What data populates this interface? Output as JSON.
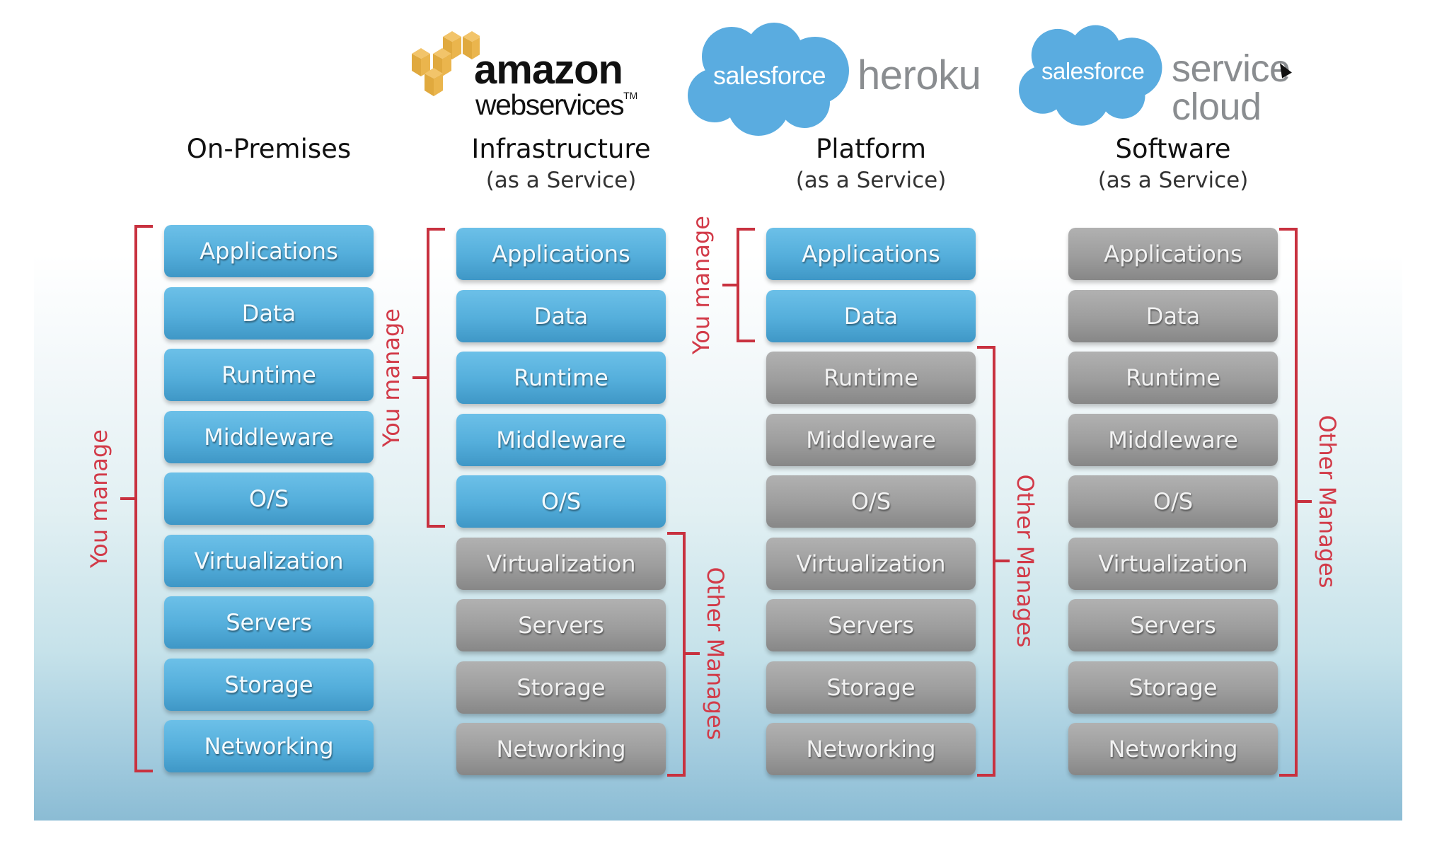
{
  "logos": {
    "aws": {
      "line1": "amazon",
      "line2": "webservices",
      "trademark": "TM",
      "cube_color": "#e8b349"
    },
    "heroku": {
      "cloud_text": "salesforce",
      "product": "heroku",
      "cloud_color": "#5aace0"
    },
    "service_cloud": {
      "cloud_text": "salesforce",
      "product": "service cloud",
      "cloud_color": "#5aace0"
    }
  },
  "colors": {
    "you_manage": "#55addb",
    "other_manages": "#9d9d9d",
    "bracket": "#c8313f"
  },
  "columns": [
    {
      "title": "On-Premises",
      "subtitle": "",
      "layers": [
        {
          "label": "Applications",
          "managed_by": "you"
        },
        {
          "label": "Data",
          "managed_by": "you"
        },
        {
          "label": "Runtime",
          "managed_by": "you"
        },
        {
          "label": "Middleware",
          "managed_by": "you"
        },
        {
          "label": "O/S",
          "managed_by": "you"
        },
        {
          "label": "Virtualization",
          "managed_by": "you"
        },
        {
          "label": "Servers",
          "managed_by": "you"
        },
        {
          "label": "Storage",
          "managed_by": "you"
        },
        {
          "label": "Networking",
          "managed_by": "you"
        }
      ],
      "you_label": "You manage",
      "other_label": ""
    },
    {
      "title": "Infrastructure",
      "subtitle": "(as a Service)",
      "layers": [
        {
          "label": "Applications",
          "managed_by": "you"
        },
        {
          "label": "Data",
          "managed_by": "you"
        },
        {
          "label": "Runtime",
          "managed_by": "you"
        },
        {
          "label": "Middleware",
          "managed_by": "you"
        },
        {
          "label": "O/S",
          "managed_by": "you"
        },
        {
          "label": "Virtualization",
          "managed_by": "other"
        },
        {
          "label": "Servers",
          "managed_by": "other"
        },
        {
          "label": "Storage",
          "managed_by": "other"
        },
        {
          "label": "Networking",
          "managed_by": "other"
        }
      ],
      "you_label": "You manage",
      "other_label": "Other Manages"
    },
    {
      "title": "Platform",
      "subtitle": "(as a Service)",
      "layers": [
        {
          "label": "Applications",
          "managed_by": "you"
        },
        {
          "label": "Data",
          "managed_by": "you"
        },
        {
          "label": "Runtime",
          "managed_by": "other"
        },
        {
          "label": "Middleware",
          "managed_by": "other"
        },
        {
          "label": "O/S",
          "managed_by": "other"
        },
        {
          "label": "Virtualization",
          "managed_by": "other"
        },
        {
          "label": "Servers",
          "managed_by": "other"
        },
        {
          "label": "Storage",
          "managed_by": "other"
        },
        {
          "label": "Networking",
          "managed_by": "other"
        }
      ],
      "you_label": "You manage",
      "other_label": "Other Manages"
    },
    {
      "title": "Software",
      "subtitle": "(as a Service)",
      "layers": [
        {
          "label": "Applications",
          "managed_by": "other"
        },
        {
          "label": "Data",
          "managed_by": "other"
        },
        {
          "label": "Runtime",
          "managed_by": "other"
        },
        {
          "label": "Middleware",
          "managed_by": "other"
        },
        {
          "label": "O/S",
          "managed_by": "other"
        },
        {
          "label": "Virtualization",
          "managed_by": "other"
        },
        {
          "label": "Servers",
          "managed_by": "other"
        },
        {
          "label": "Storage",
          "managed_by": "other"
        },
        {
          "label": "Networking",
          "managed_by": "other"
        }
      ],
      "you_label": "",
      "other_label": "Other Manages"
    }
  ]
}
